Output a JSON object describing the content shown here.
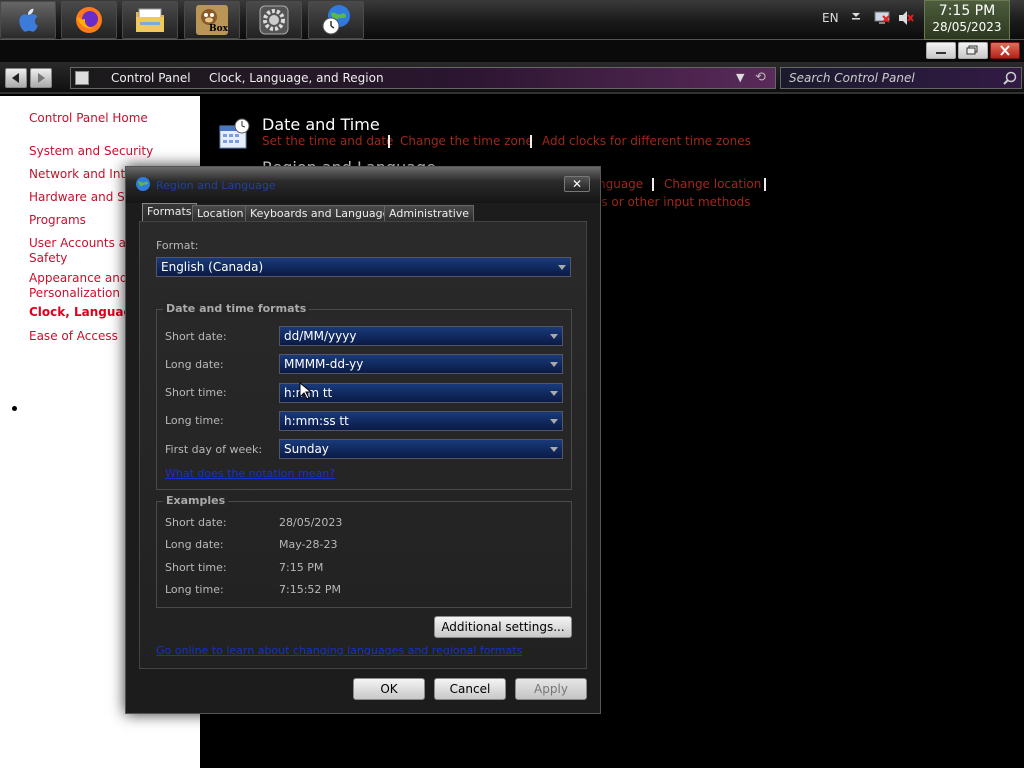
{
  "taskbar": {
    "apps": [
      {
        "name": "apple-menu"
      },
      {
        "name": "firefox"
      },
      {
        "name": "file-manager"
      },
      {
        "name": "box"
      },
      {
        "name": "system-settings"
      },
      {
        "name": "clock-globe"
      }
    ],
    "box_label": "Box",
    "tray": {
      "lang": "EN"
    },
    "clock": {
      "time": "7:15 PM",
      "date": "28/05/2023"
    }
  },
  "addressbar": {
    "crumbs": [
      "Control Panel",
      "Clock, Language, and Region"
    ],
    "search_placeholder": "Search Control Panel"
  },
  "sidebar": {
    "items": [
      {
        "label": "Control Panel Home"
      },
      {
        "label": "System and Security"
      },
      {
        "label": "Network and Inter"
      },
      {
        "label": "Hardware and So"
      },
      {
        "label": "Programs"
      },
      {
        "label": "User Accounts an\nSafety"
      },
      {
        "label": "Appearance and\nPersonalization"
      },
      {
        "label": "Clock, Language,"
      },
      {
        "label": "Ease of Access"
      }
    ]
  },
  "main": {
    "date_time": {
      "title": "Date and Time",
      "links": [
        "Set the time and date",
        "Change the time zone",
        "Add clocks for different time zones"
      ]
    },
    "region": {
      "title": "Region and Language",
      "links": [
        "nguage",
        "Change location",
        "ls or other input methods"
      ]
    }
  },
  "dialog": {
    "title": "Region and Language",
    "tabs": [
      "Formats",
      "Location",
      "Keyboards and Languages",
      "Administrative"
    ],
    "format_label": "Format:",
    "format_value": "English (Canada)",
    "dt_group_title": "Date and time formats",
    "dt_rows": [
      {
        "label": "Short date:",
        "value": "dd/MM/yyyy"
      },
      {
        "label": "Long date:",
        "value": "MMMM-dd-yy"
      },
      {
        "label": "Short time:",
        "value": "h:mm tt"
      },
      {
        "label": "Long time:",
        "value": "h:mm:ss tt"
      },
      {
        "label": "First day of week:",
        "value": "Sunday"
      }
    ],
    "notation_link": "What does the notation mean?",
    "examples_title": "Examples",
    "examples": [
      {
        "label": "Short date:",
        "value": "28/05/2023"
      },
      {
        "label": "Long date:",
        "value": "May-28-23"
      },
      {
        "label": "Short time:",
        "value": "7:15 PM"
      },
      {
        "label": "Long time:",
        "value": "7:15:52 PM"
      }
    ],
    "additional_settings": "Additional settings...",
    "online_link": "Go online to learn about changing languages and regional formats",
    "ok": "OK",
    "cancel": "Cancel",
    "apply": "Apply"
  }
}
